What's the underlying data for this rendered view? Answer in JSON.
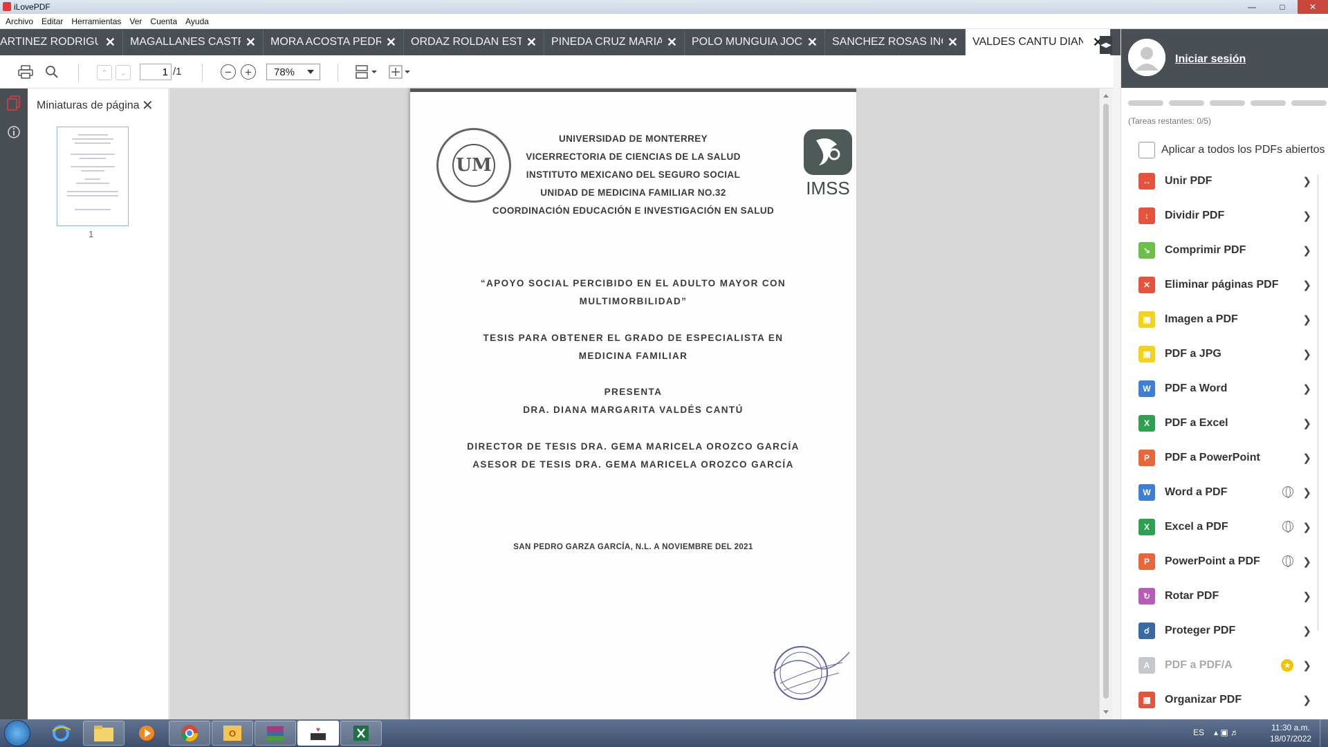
{
  "window": {
    "title": "iLovePDF"
  },
  "menu": [
    "Archivo",
    "Editar",
    "Herramientas",
    "Ver",
    "Cuenta",
    "Ayuda"
  ],
  "tabs": [
    {
      "label": "ARTINEZ RODRIGUEZ",
      "active": false
    },
    {
      "label": "MAGALLANES CASTRU",
      "active": false
    },
    {
      "label": "MORA ACOSTA PEDRO",
      "active": false
    },
    {
      "label": "ORDAZ ROLDAN ESTEI",
      "active": false
    },
    {
      "label": "PINEDA CRUZ MARIA N",
      "active": false
    },
    {
      "label": "POLO MUNGUIA JOCE",
      "active": false
    },
    {
      "label": "SANCHEZ ROSAS INGF",
      "active": false
    },
    {
      "label": "VALDES CANTU DIANA",
      "active": true
    }
  ],
  "toolbar": {
    "page_current": "1",
    "page_total": "/1",
    "zoom": "78%"
  },
  "thumbnails": {
    "title": "Miniaturas de página",
    "pages": [
      "1"
    ]
  },
  "document": {
    "header_lines": [
      "UNIVERSIDAD DE MONTERREY",
      "VICERRECTORIA DE CIENCIAS DE LA SALUD",
      "INSTITUTO MEXICANO DEL SEGURO SOCIAL",
      "UNIDAD DE MEDICINA FAMILIAR NO.32",
      "COORDINACIÓN EDUCACIÓN E INVESTIGACIÓN EN SALUD"
    ],
    "title_line1": "“APOYO SOCIAL PERCIBIDO EN EL ADULTO MAYOR CON",
    "title_line2": "MULTIMORBILIDAD”",
    "degree_line1": "TESIS PARA OBTENER EL GRADO DE ESPECIALISTA EN",
    "degree_line2": "MEDICINA FAMILIAR",
    "presenta": "PRESENTA",
    "author": "DRA. DIANA MARGARITA VALDÉS CANTÚ",
    "director": "DIRECTOR DE TESIS DRA. GEMA MARICELA OROZCO GARCÍA",
    "asesor": "ASESOR DE TESIS DRA. GEMA MARICELA OROZCO GARCÍA",
    "place_date": "SAN PEDRO GARZA GARCÍA, N.L. A NOVIEMBRE DEL 2021",
    "logo_left_text": "UM",
    "logo_right_text": "IMSS"
  },
  "sidebar": {
    "login_label": "Iniciar sesión",
    "tasks_remaining": "(Tareas restantes: 0/5)",
    "apply_all_label": "Aplicar a todos los PDFs abiertos",
    "tools": [
      {
        "label": "Unir PDF",
        "color": "#e5533d",
        "badge": ""
      },
      {
        "label": "Dividir PDF",
        "color": "#e5533d",
        "badge": ""
      },
      {
        "label": "Comprimir PDF",
        "color": "#6cc04a",
        "badge": ""
      },
      {
        "label": "Eliminar páginas PDF",
        "color": "#e5533d",
        "badge": ""
      },
      {
        "label": "Imagen a PDF",
        "color": "#f2d21b",
        "badge": ""
      },
      {
        "label": "PDF a JPG",
        "color": "#f2d21b",
        "badge": ""
      },
      {
        "label": "PDF a Word",
        "color": "#3e7fd6",
        "badge": ""
      },
      {
        "label": "PDF a Excel",
        "color": "#2fa052",
        "badge": ""
      },
      {
        "label": "PDF a PowerPoint",
        "color": "#e8663a",
        "badge": ""
      },
      {
        "label": "Word a PDF",
        "color": "#3e7fd6",
        "badge": "globe"
      },
      {
        "label": "Excel a PDF",
        "color": "#2fa052",
        "badge": "globe"
      },
      {
        "label": "PowerPoint a PDF",
        "color": "#e8663a",
        "badge": "globe"
      },
      {
        "label": "Rotar PDF",
        "color": "#b85bb5",
        "badge": ""
      },
      {
        "label": "Proteger PDF",
        "color": "#3a6aa6",
        "badge": ""
      },
      {
        "label": "PDF a PDF/A",
        "color": "#9aa0a6",
        "badge": "star"
      },
      {
        "label": "Organizar PDF",
        "color": "#e5533d",
        "badge": ""
      }
    ]
  },
  "taskbar": {
    "lang": "ES",
    "time": "11:30 a.m.",
    "date": "18/07/2022"
  },
  "colors": {
    "chrome_dark": "#4a4f56",
    "accent_red": "#e23a3a"
  }
}
